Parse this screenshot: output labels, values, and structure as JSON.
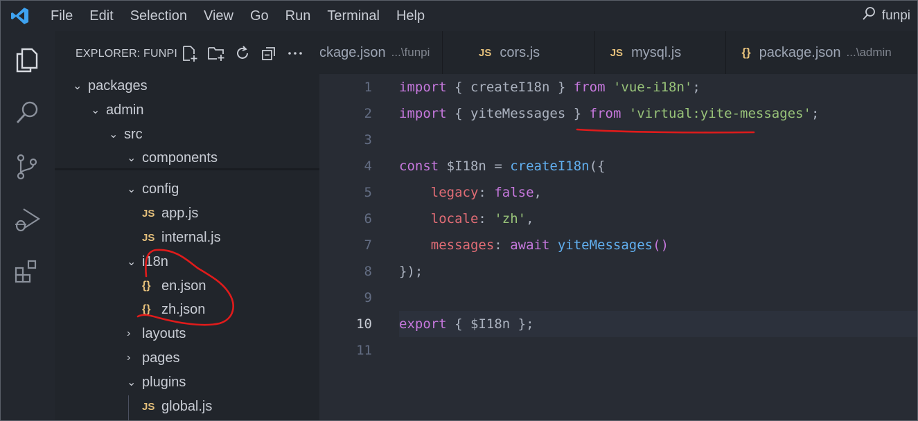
{
  "menubar": {
    "items": [
      "File",
      "Edit",
      "Selection",
      "View",
      "Go",
      "Run",
      "Terminal",
      "Help"
    ],
    "search_label": "funpi"
  },
  "sidebar": {
    "title": "EXPLORER: FUNPI",
    "tree": [
      {
        "label": "packages",
        "kind": "folder-open"
      },
      {
        "label": "admin",
        "kind": "folder-open"
      },
      {
        "label": "src",
        "kind": "folder-open"
      },
      {
        "label": "components",
        "kind": "folder-open"
      },
      {
        "label": "config",
        "kind": "folder-open"
      },
      {
        "label": "app.js",
        "kind": "js"
      },
      {
        "label": "internal.js",
        "kind": "js"
      },
      {
        "label": "i18n",
        "kind": "folder-open"
      },
      {
        "label": "en.json",
        "kind": "json"
      },
      {
        "label": "zh.json",
        "kind": "json"
      },
      {
        "label": "layouts",
        "kind": "folder-closed"
      },
      {
        "label": "pages",
        "kind": "folder-closed"
      },
      {
        "label": "plugins",
        "kind": "folder-open"
      },
      {
        "label": "global.js",
        "kind": "js"
      }
    ]
  },
  "tabs": [
    {
      "name": "ckage.json",
      "desc": "...\\funpi",
      "icon": "json"
    },
    {
      "name": "cors.js",
      "desc": "",
      "icon": "js"
    },
    {
      "name": "mysql.js",
      "desc": "",
      "icon": "js"
    },
    {
      "name": "package.json",
      "desc": "...\\admin",
      "icon": "json"
    }
  ],
  "icons": {
    "js": "JS",
    "json": "{}"
  },
  "editor": {
    "line_numbers": [
      "1",
      "2",
      "3",
      "4",
      "5",
      "6",
      "7",
      "8",
      "9",
      "10",
      "11"
    ],
    "active_line": "10"
  },
  "colors": {
    "keyword": "#c678dd",
    "string": "#98c379",
    "function": "#61afef",
    "property": "#e06c75",
    "annotation": "#e01b1b"
  }
}
